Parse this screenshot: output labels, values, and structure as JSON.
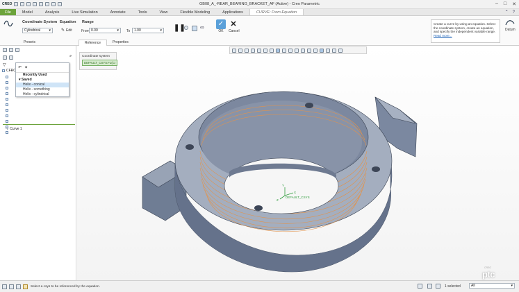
{
  "titlebar": {
    "app_logo": "CREO",
    "window_title": "GB08_A_-REAR_BEARING_BRACKET_AF (Active) - Creo Parametric"
  },
  "menu": {
    "file": "File",
    "tabs": [
      "Model",
      "Analysis",
      "Live Simulation",
      "Annotate",
      "Tools",
      "View",
      "Flexible Modeling",
      "Applications"
    ],
    "active_tab": "CURVE: From Equation"
  },
  "ribbon": {
    "coord_sys_label": "Coordinate System",
    "coord_type": "Cylindrical",
    "equation_label": "Equation",
    "edit_label": "Edit",
    "range_label": "Range",
    "from_label": "From",
    "from_value": "0.00",
    "to_label": "To",
    "to_value": "1.00",
    "ok_label": "OK",
    "cancel_label": "Cancel",
    "subtabs": [
      "Presets",
      "Reference",
      "Properties"
    ],
    "datum_label": "Datum"
  },
  "help": {
    "text": "Create a curve by using an equation. Select the coordinate system, create an equation, and specify the independent variable range.",
    "read_more": "Read more..."
  },
  "reference_panel": {
    "title": "Coordinate system",
    "chip": "DEFAULT_CSYS:F1(CI"
  },
  "presets_popup": {
    "recently_used": "Recently Used",
    "saved": "Saved",
    "items": [
      "Helix - conical",
      "Helix - something",
      "Helix - cylindrical"
    ]
  },
  "tree": {
    "root": "CFRO",
    "curve_item": "Curve 1"
  },
  "viewport": {
    "csys_label": "DEFAULT_CSYS",
    "csys_axis_x": "X",
    "csys_axis_y": "Y",
    "csys_axis_z": "Z",
    "logo_small": "CREO",
    "logo": "ptc"
  },
  "statusbar": {
    "message": "Select a csys to be referenced by the equation.",
    "selected": "1 selected",
    "filter": "All"
  }
}
